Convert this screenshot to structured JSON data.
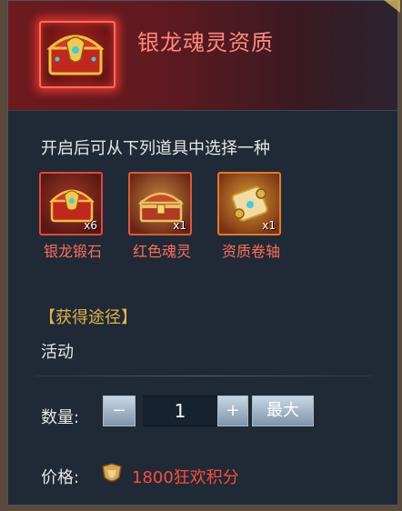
{
  "header": {
    "title": "银龙魂灵资质",
    "icon": "treasure-chest-icon"
  },
  "subtitle": "开启后可从下列道具中选择一种",
  "items": [
    {
      "label": "银龙锻石",
      "count": "x6",
      "icon": "red-chest-icon"
    },
    {
      "label": "红色魂灵",
      "count": "x1",
      "icon": "gold-chest-icon"
    },
    {
      "label": "资质卷轴",
      "count": "x1",
      "icon": "scroll-icon"
    }
  ],
  "source": {
    "title": "【获得途径】",
    "text": "活动"
  },
  "quantity": {
    "label": "数量:",
    "value": "1",
    "minus": "−",
    "plus": "+",
    "max_label": "最大"
  },
  "price": {
    "label": "价格:",
    "value": "1800狂欢积分",
    "icon": "shield-coin-icon"
  },
  "colors": {
    "title": "#ff8a7a",
    "item_label": "#ff6d58",
    "source_title": "#e0b34a",
    "price": "#ff4a3a",
    "panel_bg": "#1f2a36"
  }
}
